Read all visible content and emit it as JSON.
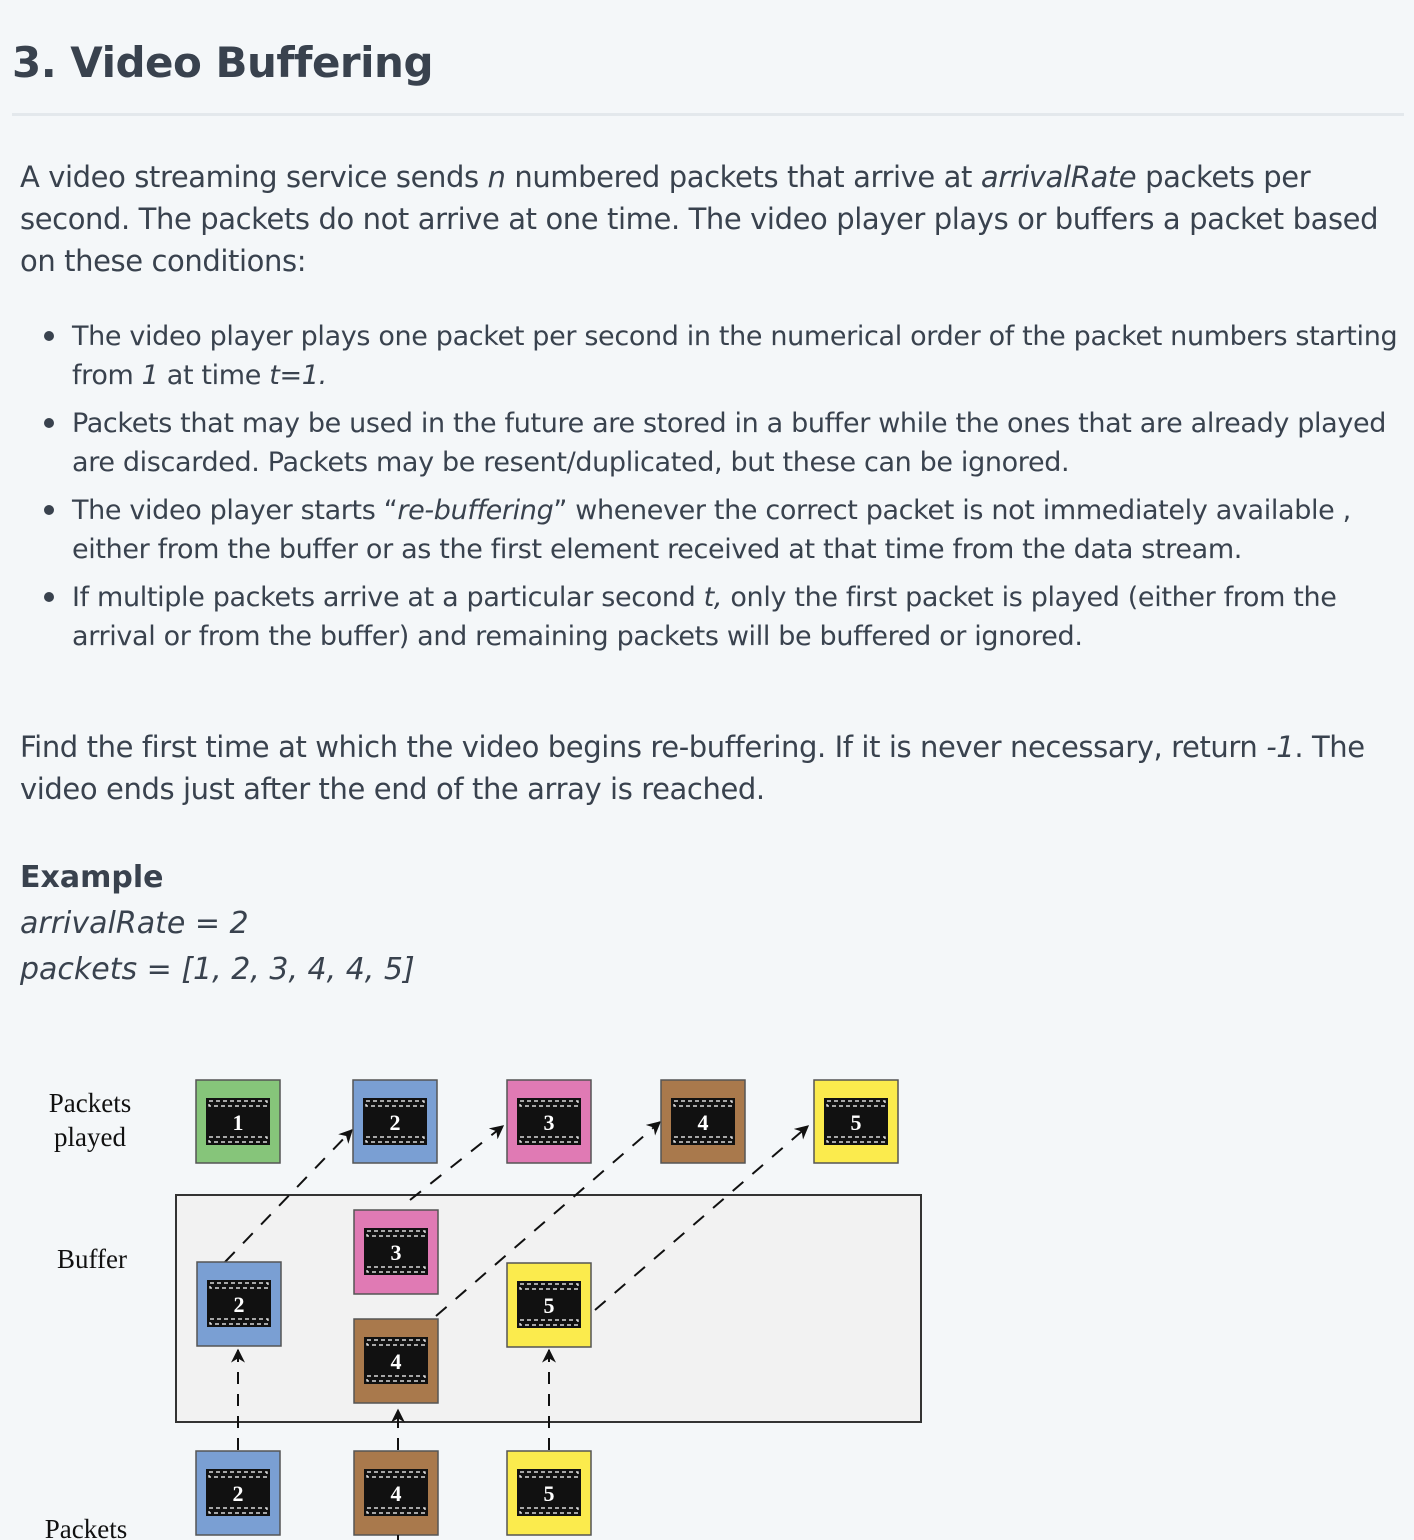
{
  "title": "3. Video Buffering",
  "intro": {
    "p1": "A video streaming service sends ",
    "n": "n",
    "p2": " numbered packets that arrive at ",
    "rate": "arrivalRate",
    "p3": " packets per second. The packets do not arrive at one time. The video player plays or buffers a packet based on these conditions:"
  },
  "bullets": {
    "b1": {
      "a": "The video player plays one packet per second in the numerical order of the packet numbers starting from ",
      "one": "1",
      "b": " at time ",
      "t": "t=1."
    },
    "b2": {
      "text": "Packets that may be used in the future are stored in a buffer while the ones that are already played are discarded. Packets may be resent/duplicated, but these can be ignored."
    },
    "b3": {
      "a": "The video player starts “",
      "em": "re-buffering",
      "b": "” whenever the correct packet is not immediately available , either from the buffer or as the first element received at that time from the data stream."
    },
    "b4": {
      "a": "If multiple packets arrive at a particular second ",
      "t": "t,",
      "b": " only the first packet is played (either from the arrival or from the buffer) and remaining packets will be buffered or ignored."
    }
  },
  "find": {
    "a": "Find the first time at which the video begins re-buffering. If it is never necessary, return ",
    "neg": "-1",
    "b": ". The video ends just after the end of the array is reached."
  },
  "example": {
    "heading": "Example",
    "rate_line": "arrivalRate = 2",
    "packets_line": "packets = [1, 2, 3, 4, 4, 5]"
  },
  "diagram": {
    "labels": {
      "played_1": "Packets",
      "played_2": "played",
      "buffer": "Buffer",
      "incoming": "Packets"
    },
    "colors": {
      "green": "#86c57a",
      "blue": "#7a9fd3",
      "pink": "#e07ab4",
      "brown": "#a9794c",
      "yellow": "#fbeb4d"
    },
    "icon": "film-frame-icon",
    "played": [
      "1",
      "2",
      "3",
      "4",
      "5"
    ],
    "buffered": [
      "2",
      "3",
      "4",
      "5"
    ],
    "incoming": [
      "2",
      "4",
      "5"
    ]
  }
}
